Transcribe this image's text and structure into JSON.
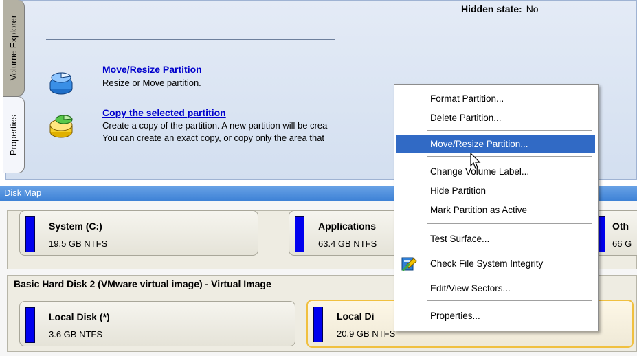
{
  "upper_panel": {
    "hidden_state_label": "Hidden state:",
    "hidden_state_value": "No",
    "tabs": {
      "volume_explorer": "Volume Explorer",
      "properties": "Properties"
    },
    "actions": {
      "move_resize": {
        "title": "Move/Resize Partition",
        "desc": "Resize or Move partition."
      },
      "copy": {
        "title": "Copy the selected partition",
        "desc1": "Create a copy of the partition. A new partition will be crea",
        "desc2": "You can create an exact copy, or copy only the area that"
      }
    }
  },
  "disk_map": {
    "header": "Disk Map",
    "row1": {
      "system": {
        "name": "System (C:)",
        "info": "19.5 GB NTFS"
      },
      "applications": {
        "name": "Applications",
        "info": "63.4 GB NTFS"
      },
      "other": {
        "name": "Oth",
        "info": "66 G"
      }
    },
    "row2_title": "Basic Hard Disk 2 (VMware virtual image) - Virtual Image",
    "row2": {
      "local1": {
        "name": "Local Disk (*)",
        "info": "3.6 GB NTFS"
      },
      "local2": {
        "name": "Local Di",
        "info": "20.9 GB NTFS"
      }
    }
  },
  "context_menu": {
    "items": [
      "Format Partition...",
      "Delete Partition...",
      "Move/Resize Partition...",
      "Change Volume Label...",
      "Hide Partition",
      "Mark Partition as Active",
      "Test Surface...",
      "Check File System Integrity",
      "Edit/View Sectors...",
      "Properties..."
    ],
    "highlighted_item": "Move/Resize Partition..."
  },
  "colors": {
    "link": "#0000cc",
    "menu_highlight": "#316ac5",
    "partition_bar": "#0000ee",
    "disk_map_header": "#3e82d6",
    "selected_partition_border": "#f0c040"
  }
}
